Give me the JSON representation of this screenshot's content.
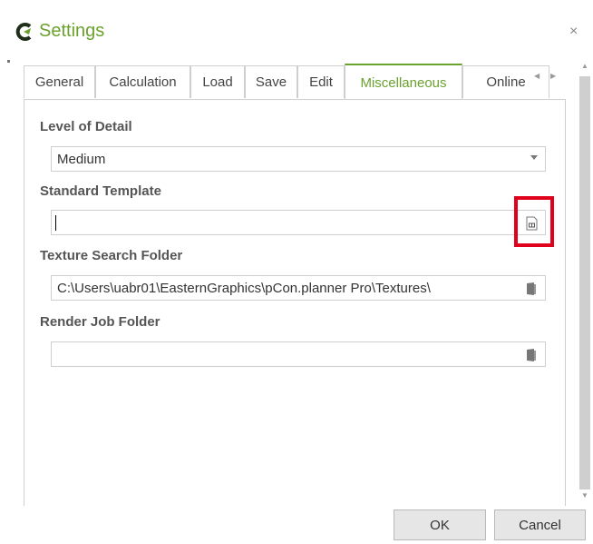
{
  "window": {
    "title": "Settings",
    "close_glyph": "×"
  },
  "tabs": [
    {
      "label": "General"
    },
    {
      "label": "Calculation"
    },
    {
      "label": "Load"
    },
    {
      "label": "Save"
    },
    {
      "label": "Edit"
    },
    {
      "label": "Miscellaneous",
      "active": true
    },
    {
      "label": "Online"
    }
  ],
  "fields": {
    "level_of_detail": {
      "label": "Level of Detail",
      "value": "Medium"
    },
    "standard_template": {
      "label": "Standard Template",
      "value": ""
    },
    "texture_search_folder": {
      "label": "Texture Search Folder",
      "value": "C:\\Users\\uabr01\\EasternGraphics\\pCon.planner Pro\\Textures\\"
    },
    "render_job_folder": {
      "label": "Render Job Folder",
      "value": ""
    }
  },
  "buttons": {
    "ok": "OK",
    "cancel": "Cancel"
  },
  "colors": {
    "accent": "#6aa22d",
    "highlight": "#e0001b"
  }
}
